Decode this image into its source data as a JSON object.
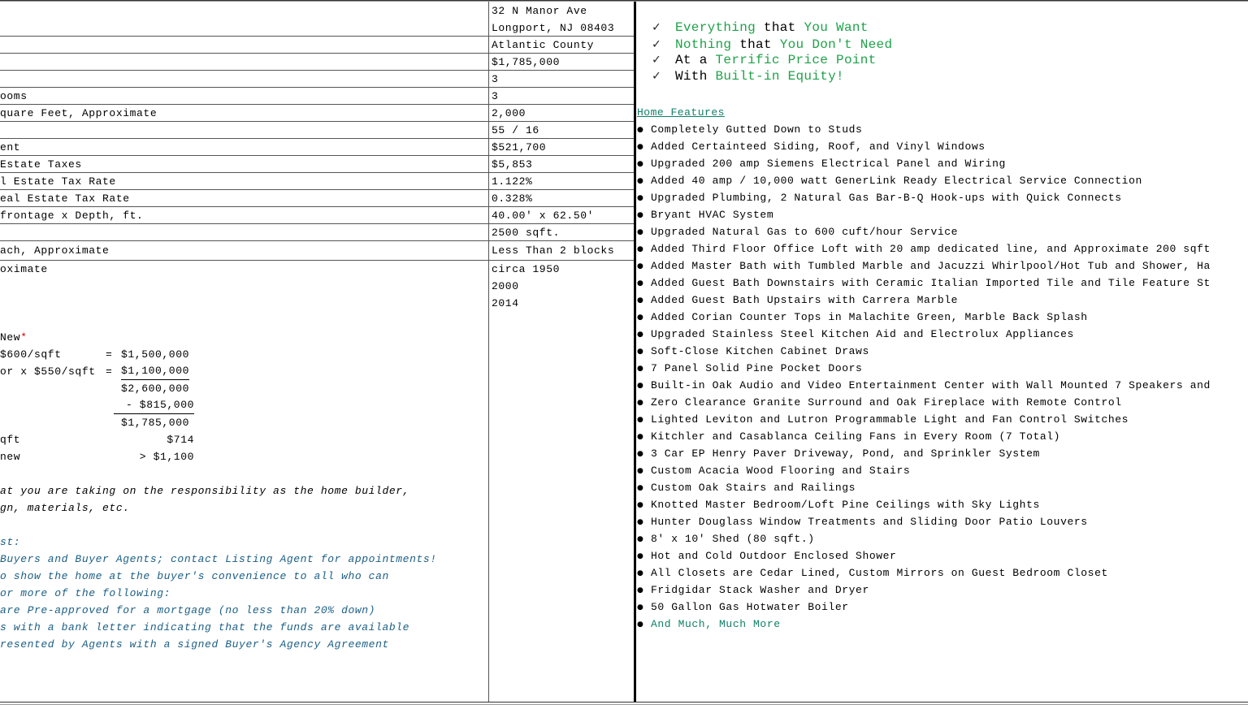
{
  "details": [
    {
      "label": "",
      "value": "32 N Manor Ave"
    },
    {
      "label": "",
      "value": "Longport, NJ 08403"
    },
    {
      "label": "",
      "value": "Atlantic County"
    },
    {
      "label": "",
      "value": "$1,785,000"
    },
    {
      "label": "",
      "value": "3"
    },
    {
      "label": "ooms",
      "value": "3"
    },
    {
      "label": "quare Feet, Approximate",
      "value": "2,000"
    },
    {
      "label": "",
      "value": "55 / 16"
    },
    {
      "label": "ent",
      "value": "$521,700"
    },
    {
      "label": "Estate Taxes",
      "value": "$5,853"
    },
    {
      "label": "l Estate Tax Rate",
      "value": "1.122%"
    },
    {
      "label": "eal Estate Tax Rate",
      "value": "0.328%"
    },
    {
      "label": "frontage x Depth, ft.",
      "value": "40.00' x 62.50'"
    },
    {
      "label": "",
      "value": "2500 sqft."
    },
    {
      "label": "ach, Approximate",
      "value": "Less Than 2 blocks"
    },
    {
      "label": "oximate",
      "value": "circa 1950"
    }
  ],
  "years_extra": [
    "2000",
    "2014"
  ],
  "calc": {
    "new_label": " New",
    "new_star": "*",
    "line1_label": "$600/sqft",
    "line1_eq": "=",
    "line1_val": "$1,500,000",
    "line2_label": "or x $550/sqft",
    "line2_eq": "=",
    "line2_val": "$1,100,000",
    "sum_val": "$2,600,000",
    "minus_val": "- $815,000",
    "total_val": "$1,785,000",
    "sqft_label": "qft",
    "sqft_val": "$714",
    "new2_label": " new",
    "new2_val": "> $1,100"
  },
  "note": {
    "line1": "at you are taking on the responsibility as the home builder,",
    "line2": "gn, materials, etc."
  },
  "showing": {
    "heading": "st:",
    "line1": " Buyers and Buyer Agents; contact Listing Agent for appointments!",
    "line2": "o show the home at the buyer's convenience to all who can",
    "line3": "or more of the following:",
    "line4": " are Pre-approved for a mortgage (no less than 20% down)",
    "line5": "s with a bank letter indicating that the funds are available",
    "line6": "resented by Agents with a signed Buyer's Agency Agreement"
  },
  "checklist": [
    {
      "check": "✓",
      "a": "Everything",
      "b": " that ",
      "c": "You Want"
    },
    {
      "check": "✓",
      "a": "Nothing",
      "b": " that ",
      "c": "You Don't Need"
    },
    {
      "check": "✓",
      "a": "At a ",
      "b": "",
      "c": "Terrific Price Point"
    },
    {
      "check": "✓",
      "a": "With ",
      "b": "",
      "c": "Built-in Equity!"
    }
  ],
  "features_heading": "Home Features",
  "features": [
    "Completely Gutted Down to Studs",
    "Added Certainteed Siding, Roof, and Vinyl Windows",
    "Upgraded 200 amp Siemens Electrical Panel and Wiring",
    "Added 40 amp / 10,000 watt GenerLink Ready Electrical Service Connection",
    "Upgraded Plumbing, 2 Natural Gas Bar-B-Q Hook-ups with Quick Connects",
    "Bryant HVAC System",
    "Upgraded Natural Gas to 600 cuft/hour Service",
    "Added Third Floor Office Loft with 20 amp dedicated line, and Approximate 200 sqft",
    "Added Master Bath with Tumbled Marble and Jacuzzi Whirlpool/Hot Tub and Shower, Ha",
    "Added Guest Bath Downstairs with Ceramic Italian Imported Tile and Tile Feature St",
    "Added Guest Bath Upstairs with Carrera Marble",
    "Added Corian Counter Tops in Malachite Green, Marble Back Splash",
    "Upgraded Stainless Steel Kitchen Aid and Electrolux Appliances",
    "Soft-Close Kitchen Cabinet Draws",
    "7 Panel Solid Pine Pocket Doors",
    "Built-in Oak Audio and Video Entertainment Center with Wall Mounted 7 Speakers and",
    "Zero Clearance Granite Surround and Oak Fireplace with Remote Control",
    "Lighted Leviton and Lutron Programmable Light and Fan Control Switches",
    "Kitchler and Casablanca Ceiling Fans in Every Room (7 Total)",
    "3 Car EP Henry Paver Driveway, Pond, and Sprinkler System",
    "Custom Acacia Wood Flooring and Stairs",
    "Custom Oak Stairs and Railings",
    "Knotted Master Bedroom/Loft Pine Ceilings with Sky Lights",
    "Hunter Douglass Window Treatments and Sliding Door Patio Louvers",
    "8' x 10' Shed (80 sqft.)",
    "Hot and Cold Outdoor Enclosed Shower",
    "All Closets are Cedar Lined, Custom Mirrors on Guest Bedroom Closet",
    "Fridgidar Stack Washer and Dryer",
    "50 Gallon Gas Hotwater Boiler"
  ],
  "features_last": "And Much, Much More"
}
